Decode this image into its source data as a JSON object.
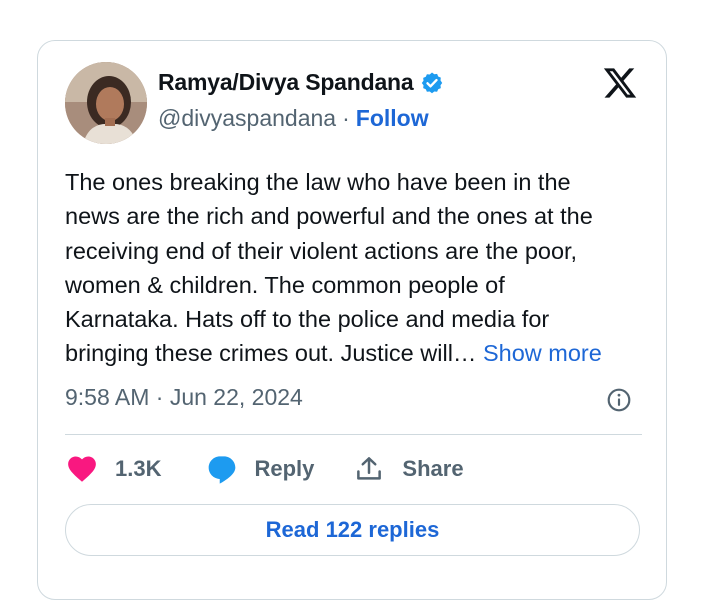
{
  "author": {
    "display_name": "Ramya/Divya Spandana",
    "handle": "@divyaspandana",
    "separator": "·",
    "follow_label": "Follow",
    "verified": true
  },
  "tweet": {
    "lines": [
      "The ones breaking the law who have been in the",
      "news are the rich and powerful and the ones at the",
      "receiving end of their violent  actions are the poor,",
      "women & children. The common people of",
      "Karnataka. Hats off to the police and media for",
      "bringing these crimes out. Justice will…"
    ],
    "show_more_label": "Show more",
    "timestamp": "9:58 AM · Jun 22, 2024"
  },
  "actions": {
    "like_count": "1.3K",
    "reply_label": "Reply",
    "share_label": "Share"
  },
  "read_replies_label": "Read 122 replies",
  "colors": {
    "link_blue": "#1d67d6",
    "verified_blue": "#1d9bf0",
    "heart_pink": "#f91880",
    "muted_text": "#536471",
    "border": "#cfd9de"
  },
  "icons": {
    "verified": "verified-badge-icon",
    "x_logo": "x-logo-icon",
    "info": "info-icon",
    "like": "heart-icon",
    "reply": "speech-bubble-icon",
    "share": "upload-icon"
  }
}
